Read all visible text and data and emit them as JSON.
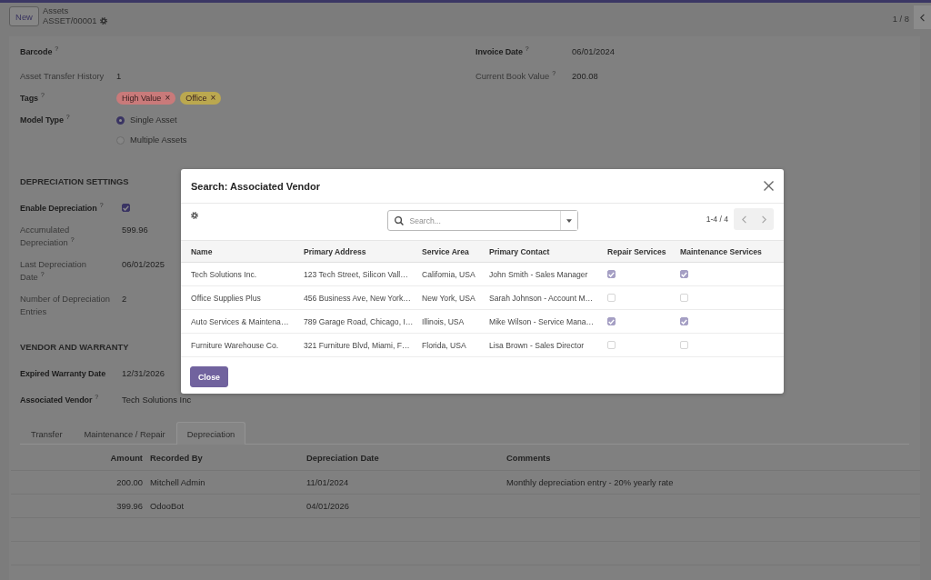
{
  "control_panel": {
    "new_button": "New",
    "breadcrumb": "Assets",
    "record": "ASSET/00001",
    "pager": "1 / 8"
  },
  "form": {
    "groups": [
      {
        "fields": [
          {
            "label": "Barcode$^{?}$",
            "readonly": false,
            "kind": "text"
          },
          {
            "label": "Asset Transfer History",
            "readonly": true,
            "kind": "text",
            "value": "1"
          },
          {
            "label": "Tags$^{?}$",
            "readonly": false,
            "kind": "tags",
            "tags": [
              {
                "label": "High Value",
                "remove": "×",
                "color": "#c97a7a"
              },
              {
                "label": "Office",
                "remove": "×",
                "color": "#bba84f"
              }
            ]
          },
          {
            "label": "Model Type$^{?}$",
            "readonly": false,
            "kind": "radio",
            "options": [
              {
                "label": "Single Asset",
                "selected": true
              },
              {
                "label": "Multiple Assets",
                "selected": false
              }
            ]
          }
        ]
      },
      {
        "fields": [
          {
            "label": "Invoice Date$^{?}$",
            "readonly": false,
            "kind": "text",
            "value": "06/01/2024"
          },
          {
            "label": "Current Book Value$^{?}$",
            "readonly": true,
            "kind": "text",
            "value": "200.08"
          }
        ]
      }
    ],
    "sections": [
      {
        "title": "DEPRECIATION SETTINGS",
        "fields": [
          {
            "label": "Enable Depreciation$^{?}$",
            "readonly": false,
            "kind": "checkbox",
            "checked": true
          },
          {
            "label": "Accumulated Depreciation$^{?}$",
            "readonly": true,
            "kind": "text",
            "value": "599.96"
          },
          {
            "label": "Last Depreciation Date$^{?}$",
            "readonly": true,
            "kind": "text",
            "value": "06/01/2025"
          },
          {
            "label": "Number of Depreciation Entries",
            "readonly": true,
            "kind": "text",
            "value": "2"
          }
        ]
      },
      {
        "title": "VENDOR AND WARRANTY",
        "fields": [
          {
            "label": "Expired Warranty Date",
            "readonly": false,
            "kind": "text",
            "value": "12/31/2026"
          },
          {
            "label": "Associated Vendor$^{?}$",
            "readonly": false,
            "kind": "text",
            "value": "Tech Solutions Inc"
          }
        ]
      }
    ],
    "notebook": {
      "tabs": [
        {
          "label": "Transfer",
          "selected": false
        },
        {
          "label": "Maintenance / Repair",
          "selected": false
        },
        {
          "label": "Depreciation",
          "selected": true
        }
      ],
      "table": {
        "columns": [
          {
            "label": "Amount",
            "kind": "number"
          },
          {
            "label": "Recorded By",
            "kind": "text"
          },
          {
            "label": "Depreciation Date",
            "kind": "text"
          },
          {
            "label": "Comments",
            "kind": "text"
          }
        ],
        "rows": [
          {
            "cells": [
              "200.00",
              "Mitchell Admin",
              "11/01/2024",
              "Monthly depreciation entry - 20% yearly rate"
            ]
          },
          {
            "cells": [
              "399.96",
              "OdooBot",
              "04/01/2026"
            ]
          }
        ]
      }
    }
  },
  "dialog": {
    "title": "Search: Associated Vendor",
    "search": {
      "placeholder": "Search..."
    },
    "pager": "1-4 / 4",
    "table": {
      "columns": [
        {
          "label": "Name",
          "kind": "text"
        },
        {
          "label": "Primary Address",
          "kind": "text"
        },
        {
          "label": "Service Area",
          "kind": "text"
        },
        {
          "label": "Primary Contact",
          "kind": "text"
        },
        {
          "label": "Repair Services",
          "kind": "check"
        },
        {
          "label": "Maintenance Services",
          "kind": "check"
        }
      ],
      "rows": [
        {
          "cells": [
            "Tech Solutions Inc.",
            "123 Tech Street, Silicon Vall…",
            "California, USA",
            "John Smith - Sales Manager",
            true,
            true
          ]
        },
        {
          "cells": [
            "Office Supplies Plus",
            "456 Business Ave, New York…",
            "New York, USA",
            "Sarah Johnson - Account M…",
            false,
            false
          ]
        },
        {
          "cells": [
            "Auto Services & Maintena…",
            "789 Garage Road, Chicago, I…",
            "Illinois, USA",
            "Mike Wilson - Service Mana…",
            true,
            true
          ]
        },
        {
          "cells": [
            "Furniture Warehouse Co.",
            "321 Furniture Blvd, Miami, F…",
            "Florida, USA",
            "Lisa Brown - Sales Director",
            false,
            false
          ]
        }
      ]
    },
    "buttons": [
      "Close"
    ]
  }
}
